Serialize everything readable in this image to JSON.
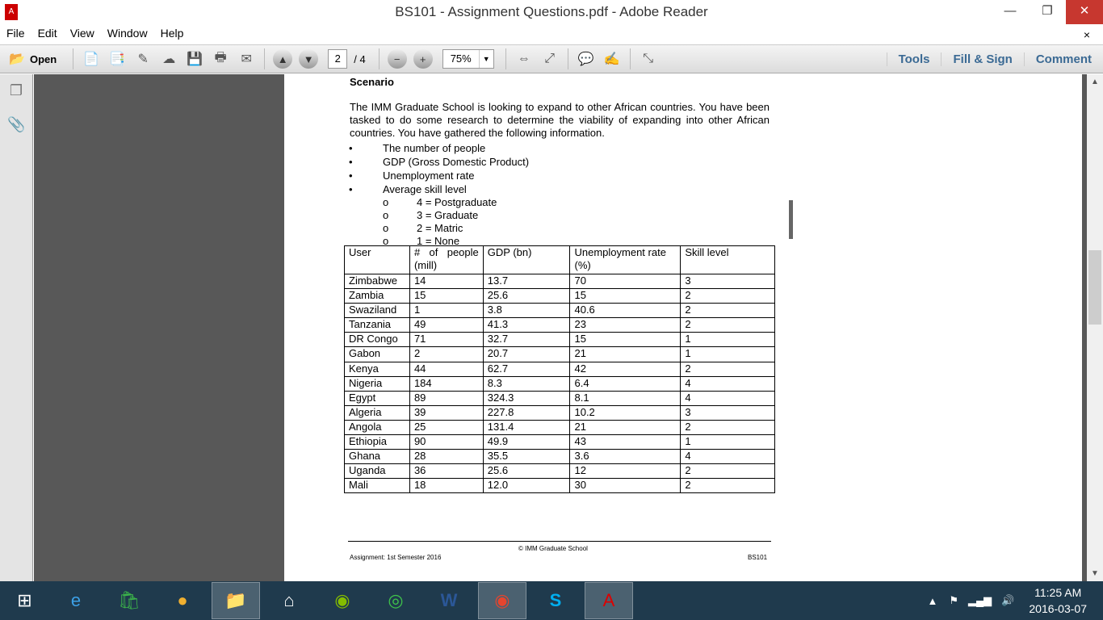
{
  "window": {
    "title": "BS101 - Assignment Questions.pdf - Adobe Reader",
    "minimize": "—",
    "maximize": "❐",
    "close": "✕"
  },
  "menu": [
    "File",
    "Edit",
    "View",
    "Window",
    "Help"
  ],
  "menu_close": "×",
  "toolbar": {
    "open": "Open",
    "page_current": "2",
    "page_total": "/ 4",
    "zoom": "75%",
    "tools": "Tools",
    "fill_sign": "Fill & Sign",
    "comment": "Comment"
  },
  "doc": {
    "heading": "Scenario",
    "para": "The IMM Graduate School is looking to expand to other African countries.  You have been tasked to do some research to determine the viability of expanding into other African countries.  You have gathered the following information.",
    "bullets": [
      "The number of people",
      "GDP (Gross Domestic Product)",
      "Unemployment rate",
      "Average skill level"
    ],
    "sub_bullets": [
      "4 = Postgraduate",
      "3 = Graduate",
      "2 = Matric",
      "1 = None"
    ],
    "table_headers": [
      "User",
      "# of people (mill)",
      "GDP (bn)",
      "Unemployment rate (%)",
      "Skill level"
    ],
    "rows": [
      [
        "Zimbabwe",
        "14",
        "13.7",
        "70",
        "3"
      ],
      [
        "Zambia",
        "15",
        "25.6",
        "15",
        "2"
      ],
      [
        "Swaziland",
        "1",
        "3.8",
        "40.6",
        "2"
      ],
      [
        "Tanzania",
        "49",
        "41.3",
        "23",
        "2"
      ],
      [
        "DR Congo",
        "71",
        "32.7",
        "15",
        "1"
      ],
      [
        "Gabon",
        "2",
        "20.7",
        "21",
        "1"
      ],
      [
        "Kenya",
        "44",
        "62.7",
        "42",
        "2"
      ],
      [
        "Nigeria",
        "184",
        "8.3",
        "6.4",
        "4"
      ],
      [
        "Egypt",
        "89",
        "324.3",
        "8.1",
        "4"
      ],
      [
        "Algeria",
        "39",
        "227.8",
        "10.2",
        "3"
      ],
      [
        "Angola",
        "25",
        "131.4",
        "21",
        "2"
      ],
      [
        "Ethiopia",
        "90",
        "49.9",
        "43",
        "1"
      ],
      [
        "Ghana",
        "28",
        "35.5",
        "3.6",
        "4"
      ],
      [
        "Uganda",
        "36",
        "25.6",
        "12",
        "2"
      ],
      [
        "Mali",
        "18",
        "12.0",
        "30",
        "2"
      ]
    ],
    "footer_center": "© IMM Graduate School",
    "footer_left": "Assignment: 1st Semester 2016",
    "footer_right": "BS101"
  },
  "clock": {
    "time": "11:25 AM",
    "date": "2016-03-07"
  }
}
